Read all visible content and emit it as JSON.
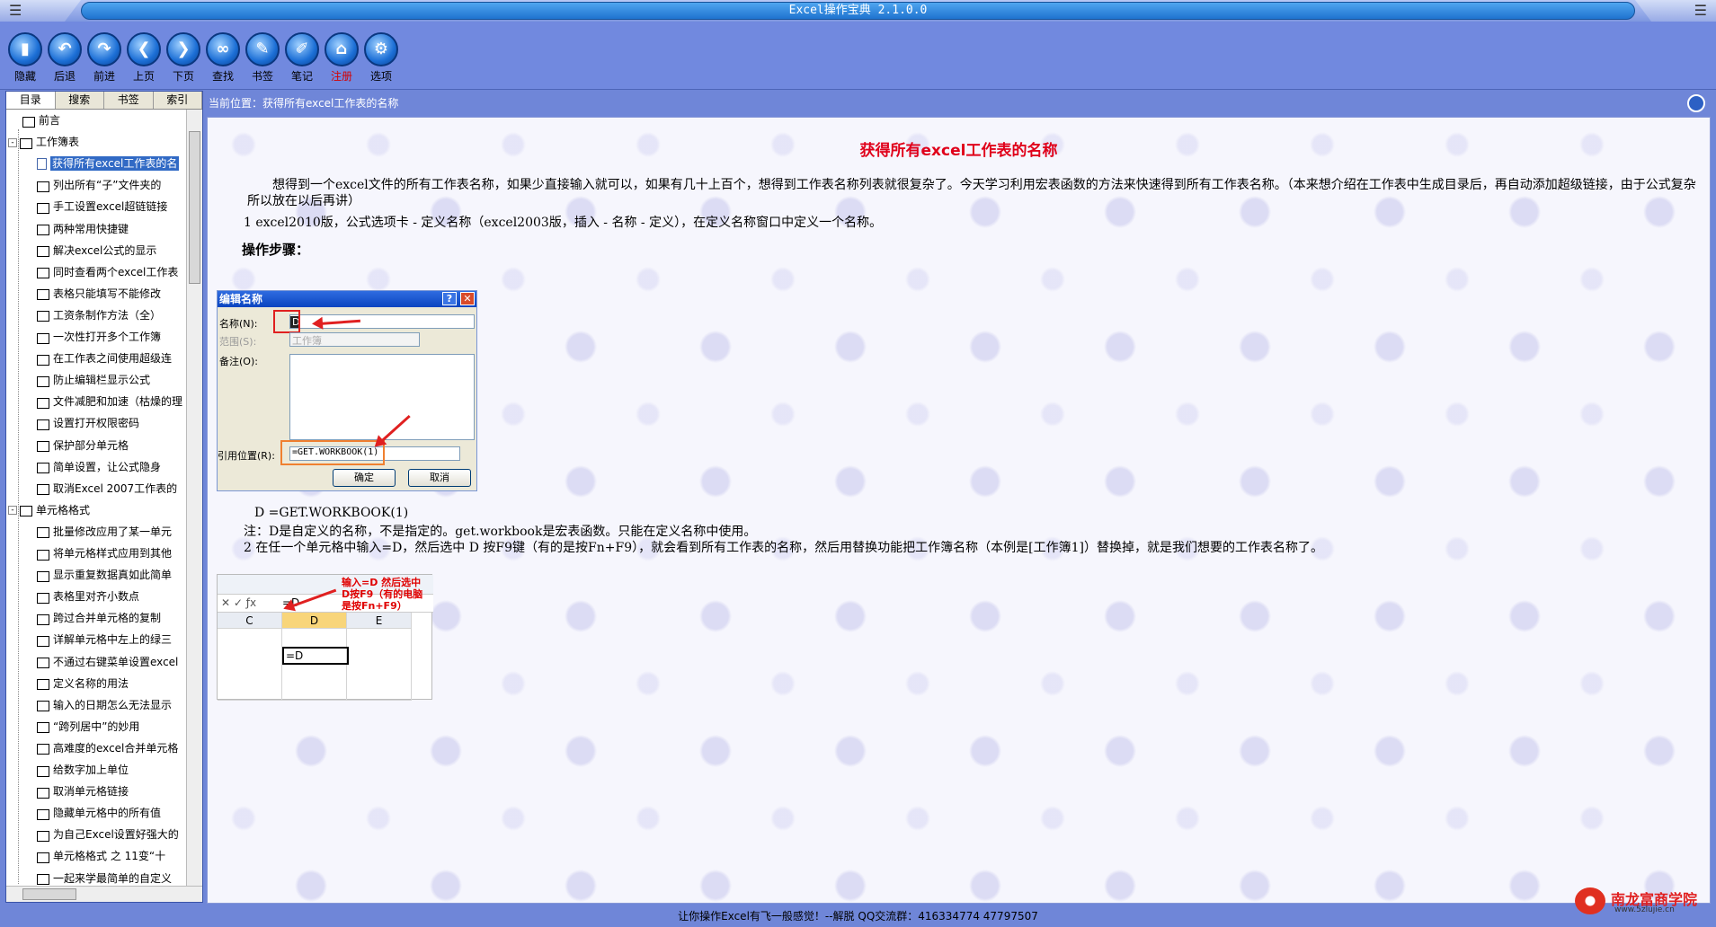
{
  "window": {
    "title": "Excel操作宝典 2.1.0.0"
  },
  "toolbar": [
    {
      "label": "隐藏",
      "icon": "hide-icon",
      "glyph": "▮"
    },
    {
      "label": "后退",
      "icon": "back-icon",
      "glyph": "↶"
    },
    {
      "label": "前进",
      "icon": "forward-icon",
      "glyph": "↷"
    },
    {
      "label": "上页",
      "icon": "prev-page-icon",
      "glyph": "❮"
    },
    {
      "label": "下页",
      "icon": "next-page-icon",
      "glyph": "❯"
    },
    {
      "label": "查找",
      "icon": "find-icon",
      "glyph": "∞"
    },
    {
      "label": "书签",
      "icon": "bookmark-icon",
      "glyph": "✎"
    },
    {
      "label": "笔记",
      "icon": "note-icon",
      "glyph": "✐"
    },
    {
      "label": "注册",
      "icon": "register-icon",
      "glyph": "⌂",
      "red": true
    },
    {
      "label": "选项",
      "icon": "options-icon",
      "glyph": "⚙"
    }
  ],
  "tabs": [
    "目录",
    "搜索",
    "书签",
    "索引"
  ],
  "tree": [
    {
      "label": "前言",
      "level": 0,
      "type": "book"
    },
    {
      "label": "工作簿表",
      "level": 0,
      "type": "book",
      "expand": "-"
    },
    {
      "label": "获得所有excel工作表的名",
      "level": 1,
      "type": "page",
      "selected": true
    },
    {
      "label": "列出所有“子”文件夹的",
      "level": 1,
      "type": "book"
    },
    {
      "label": "手工设置excel超链链接",
      "level": 1,
      "type": "book"
    },
    {
      "label": "两种常用快捷键",
      "level": 1,
      "type": "book"
    },
    {
      "label": "解决excel公式的显示",
      "level": 1,
      "type": "book"
    },
    {
      "label": "同时查看两个excel工作表",
      "level": 1,
      "type": "book"
    },
    {
      "label": "表格只能填写不能修改",
      "level": 1,
      "type": "book"
    },
    {
      "label": "工资条制作方法（全）",
      "level": 1,
      "type": "book"
    },
    {
      "label": "一次性打开多个工作簿",
      "level": 1,
      "type": "book"
    },
    {
      "label": "在工作表之间使用超级连",
      "level": 1,
      "type": "book"
    },
    {
      "label": "防止编辑栏显示公式",
      "level": 1,
      "type": "book"
    },
    {
      "label": "文件减肥和加速（枯燥的理",
      "level": 1,
      "type": "book"
    },
    {
      "label": "设置打开权限密码",
      "level": 1,
      "type": "book"
    },
    {
      "label": "保护部分单元格",
      "level": 1,
      "type": "book"
    },
    {
      "label": "简单设置，让公式隐身",
      "level": 1,
      "type": "book"
    },
    {
      "label": "取消Excel 2007工作表的",
      "level": 1,
      "type": "book"
    },
    {
      "label": "单元格格式",
      "level": 0,
      "type": "book",
      "expand": "-"
    },
    {
      "label": "批量修改应用了某一单元",
      "level": 1,
      "type": "book"
    },
    {
      "label": "将单元格样式应用到其他",
      "level": 1,
      "type": "book"
    },
    {
      "label": "显示重复数据真如此简单",
      "level": 1,
      "type": "book"
    },
    {
      "label": "表格里对齐小数点",
      "level": 1,
      "type": "book"
    },
    {
      "label": "跨过合并单元格的复制",
      "level": 1,
      "type": "book"
    },
    {
      "label": "详解单元格中左上的绿三",
      "level": 1,
      "type": "book"
    },
    {
      "label": "不通过右键菜单设置excel",
      "level": 1,
      "type": "book"
    },
    {
      "label": "定义名称的用法",
      "level": 1,
      "type": "book"
    },
    {
      "label": "输入的日期怎么无法显示",
      "level": 1,
      "type": "book"
    },
    {
      "label": "“跨列居中”的妙用",
      "level": 1,
      "type": "book"
    },
    {
      "label": "高难度的excel合并单元格",
      "level": 1,
      "type": "book"
    },
    {
      "label": "给数字加上单位",
      "level": 1,
      "type": "book"
    },
    {
      "label": "取消单元格链接",
      "level": 1,
      "type": "book"
    },
    {
      "label": "隐藏单元格中的所有值",
      "level": 1,
      "type": "book"
    },
    {
      "label": "为自己Excel设置好强大的",
      "level": 1,
      "type": "book"
    },
    {
      "label": "单元格格式 之 11变“十",
      "level": 1,
      "type": "book"
    },
    {
      "label": "一起来学最简单的自定义",
      "level": 1,
      "type": "book"
    }
  ],
  "breadcrumb": "当前位置：获得所有excel工作表的名称",
  "article": {
    "title": "获得所有excel工作表的名称",
    "intro": "想得到一个excel文件的所有工作表名称，如果少直接输入就可以，如果有几十上百个，想得到工作表名称列表就很复杂了。今天学习利用宏表函数的方法来快速得到所有工作表名称。（本来想介绍在工作表中生成目录后，再自动添加超级链接，由于公式复杂所以放在以后再讲）",
    "steps_heading": "操作步骤：",
    "step1": "1 excel2010版，公式选项卡 - 定义名称（excel2003版，插入 - 名称 - 定义），在定义名称窗口中定义一个名称。",
    "formula_line": "D  =GET.WORKBOOK(1)",
    "note": "注：D是自定义的名称，不是指定的。get.workbook是宏表函数。只能在定义名称中使用。",
    "step2": "2 在任一个单元格中输入=D，然后选中 D 按F9键（有的是按Fn+F9），就会看到所有工作表的名称，然后用替换功能把工作簿名称（本例是[工作簿1]）替换掉，就是我们想要的工作表名称了。"
  },
  "dialog": {
    "title": "编辑名称",
    "help": "?",
    "close": "✕",
    "name_label": "名称(N):",
    "name_value": "D",
    "scope_label": "范围(S):",
    "scope_value": "工作簿",
    "comment_label": "备注(O):",
    "ref_label": "引用位置(R):",
    "ref_value": "=GET.WORKBOOK(1)",
    "ok": "确定",
    "cancel": "取消"
  },
  "excel": {
    "annotation": [
      "输入=D 然后选中",
      "D按F9（有的电脑",
      "是按Fn+F9）"
    ],
    "formula": "=D",
    "cols": [
      "C",
      "D",
      "E"
    ],
    "cell_value": "=D"
  },
  "statusbar": "让你操作Excel有飞一般感觉！--解脱  QQ交流群：416334774   47797507",
  "logo": {
    "text": "南龙富商学院",
    "sub": "www.5zlujie.cn"
  }
}
